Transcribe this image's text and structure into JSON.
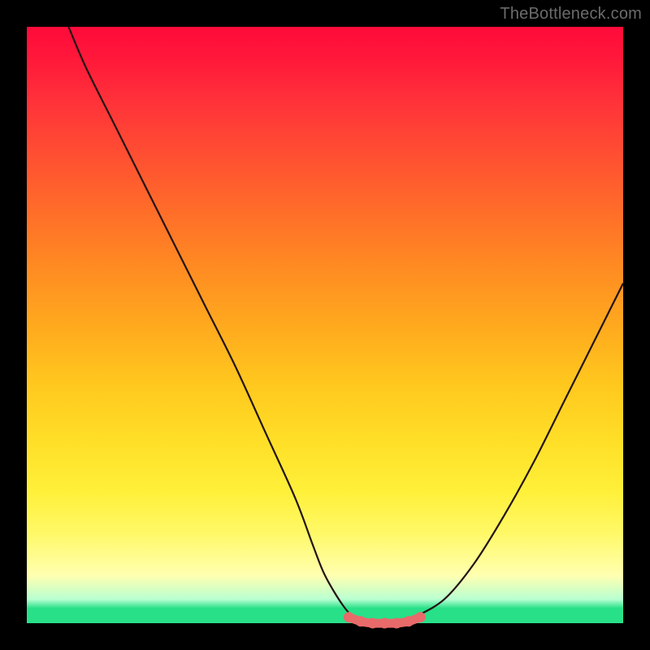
{
  "watermark": "TheBottleneck.com",
  "colors": {
    "frame": "#000000",
    "curve_stroke": "#241414",
    "dot_fill": "#e86a6a",
    "gradient_top": "#ff0a3a",
    "gradient_mid": "#ffe028",
    "gradient_bottom_green": "#28e088"
  },
  "chart_data": {
    "type": "line",
    "title": "",
    "xlabel": "",
    "ylabel": "",
    "xlim": [
      0,
      100
    ],
    "ylim": [
      0,
      100
    ],
    "series": [
      {
        "name": "bottleneck-curve",
        "x": [
          7,
          10,
          15,
          20,
          25,
          30,
          35,
          40,
          45,
          48,
          50,
          53,
          55,
          58,
          60,
          63,
          65,
          70,
          75,
          80,
          85,
          90,
          95,
          100
        ],
        "values": [
          100,
          93,
          83,
          73,
          63,
          53,
          43,
          32,
          21,
          13,
          8,
          3,
          1,
          0,
          0,
          0,
          1,
          4,
          10,
          18,
          27,
          37,
          47,
          57
        ]
      }
    ],
    "annotations": {
      "flat_bottom_dots_x": [
        54,
        56,
        58,
        60,
        62,
        64,
        66
      ],
      "flat_bottom_dots_y": [
        1,
        0.3,
        0,
        0,
        0,
        0.3,
        1
      ]
    }
  }
}
